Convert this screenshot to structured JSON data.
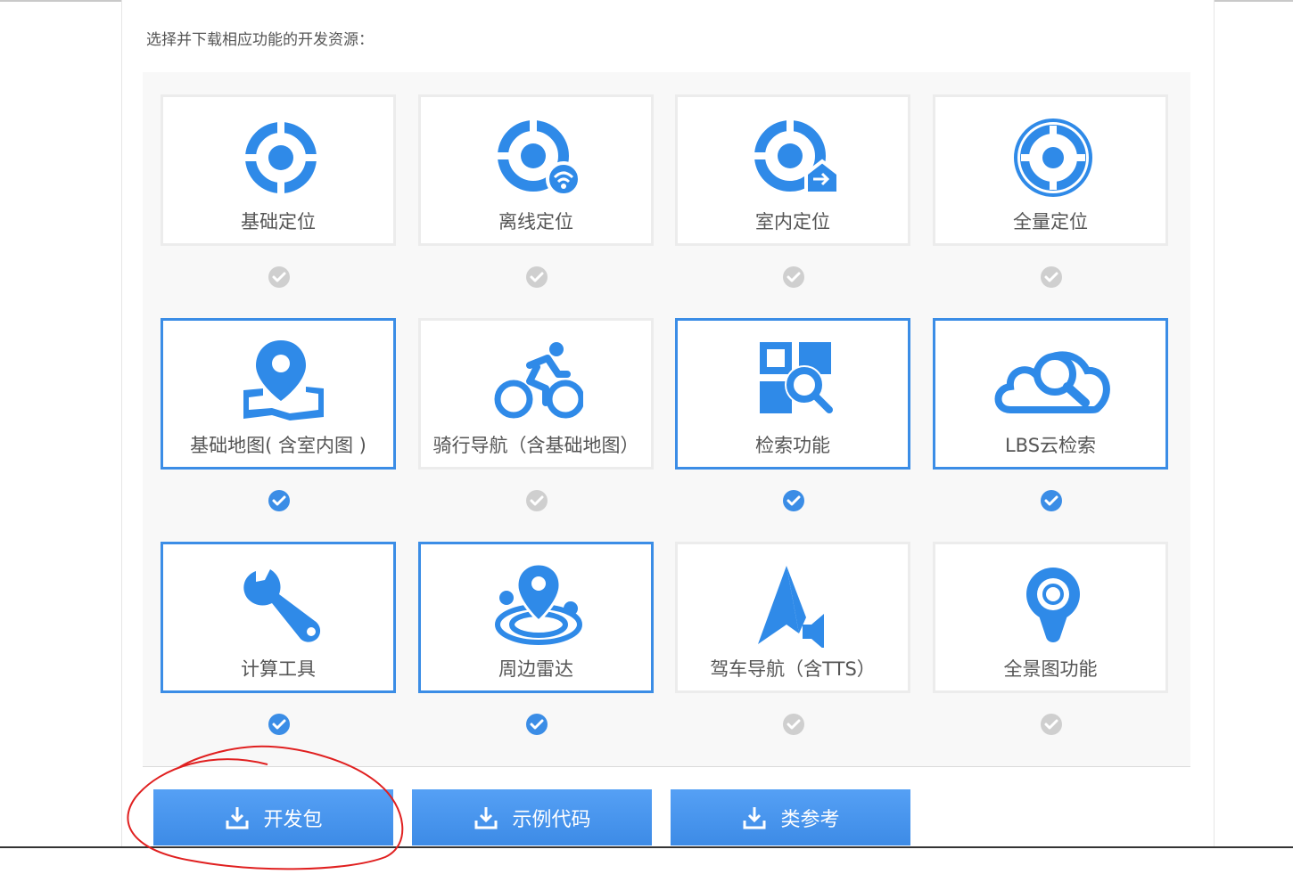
{
  "instruction": "选择并下载相应功能的开发资源：",
  "colors": {
    "accent": "#3b8de6",
    "selected_border": "#3b8de6",
    "unchecked": "#cfcfcf",
    "annotation": "#e02020"
  },
  "cards": [
    {
      "label": "基础定位",
      "icon": "locate-icon",
      "selected": false
    },
    {
      "label": "离线定位",
      "icon": "offline-locate-icon",
      "selected": false
    },
    {
      "label": "室内定位",
      "icon": "indoor-locate-icon",
      "selected": false
    },
    {
      "label": "全量定位",
      "icon": "full-locate-icon",
      "selected": false
    },
    {
      "label": "基础地图( 含室内图 )",
      "icon": "map-pin-icon",
      "selected": true
    },
    {
      "label": "骑行导航（含基础地图）",
      "icon": "bicycle-icon",
      "selected": false
    },
    {
      "label": "检索功能",
      "icon": "search-grid-icon",
      "selected": true
    },
    {
      "label": "LBS云检索",
      "icon": "cloud-search-icon",
      "selected": true
    },
    {
      "label": "计算工具",
      "icon": "wrench-icon",
      "selected": true
    },
    {
      "label": "周边雷达",
      "icon": "radar-icon",
      "selected": true
    },
    {
      "label": "驾车导航（含TTS）",
      "icon": "navigation-arrow-icon",
      "selected": false
    },
    {
      "label": "全景图功能",
      "icon": "panorama-pin-icon",
      "selected": false
    }
  ],
  "buttons": [
    {
      "label": "开发包",
      "icon": "download-icon"
    },
    {
      "label": "示例代码",
      "icon": "download-icon"
    },
    {
      "label": "类参考",
      "icon": "download-icon"
    }
  ]
}
